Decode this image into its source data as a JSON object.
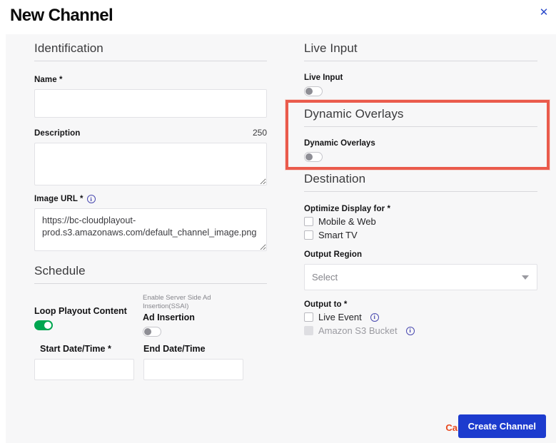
{
  "dialog": {
    "title": "New Channel",
    "close_icon": "close-x-icon"
  },
  "left_column": {
    "identification": {
      "heading": "Identification",
      "name": {
        "label": "Name *",
        "value": "",
        "placeholder": ""
      },
      "description": {
        "label": "Description",
        "counter": "250",
        "value": "",
        "placeholder": ""
      },
      "image_url": {
        "label": "Image URL *",
        "info_icon": "info-circle-icon",
        "value": "https://bc-cloudplayout-prod.s3.amazonaws.com/default_channel_image.png"
      }
    },
    "schedule": {
      "heading": "Schedule",
      "loop_playout": {
        "label": "Loop Playout Content",
        "state": "on"
      },
      "ad_insertion": {
        "hint": "Enable Server Side Ad Insertion(SSAI)",
        "label": "Ad Insertion",
        "state": "off"
      },
      "start_date": {
        "label": "Start Date/Time *",
        "value": ""
      },
      "end_date": {
        "label": "End Date/Time",
        "value": ""
      }
    }
  },
  "right_column": {
    "live_input": {
      "heading": "Live Input",
      "toggle_label": "Live Input",
      "state": "off"
    },
    "dynamic_overlays": {
      "heading": "Dynamic Overlays",
      "toggle_label": "Dynamic Overlays",
      "state": "off",
      "highlight_color": "#ea5b4c"
    },
    "destination": {
      "heading": "Destination",
      "optimize_label": "Optimize Display for *",
      "optimize_options": [
        {
          "label": "Mobile & Web",
          "checked": false,
          "disabled": false
        },
        {
          "label": "Smart TV",
          "checked": false,
          "disabled": false
        }
      ],
      "output_region_label": "Output Region",
      "output_region_value": "Select",
      "caret_icon": "chevron-down-icon",
      "output_to_label": "Output to *",
      "output_to_options": [
        {
          "label": "Live Event",
          "checked": false,
          "disabled": false,
          "info_icon": "info-circle-icon"
        },
        {
          "label": "Amazon S3 Bucket",
          "checked": false,
          "disabled": true,
          "info_icon": "info-circle-icon"
        }
      ]
    }
  },
  "footer": {
    "cancel_label": "Cancel",
    "submit_label": "Create Channel",
    "cancel_color": "#e8491f",
    "submit_color": "#1c3bce"
  }
}
